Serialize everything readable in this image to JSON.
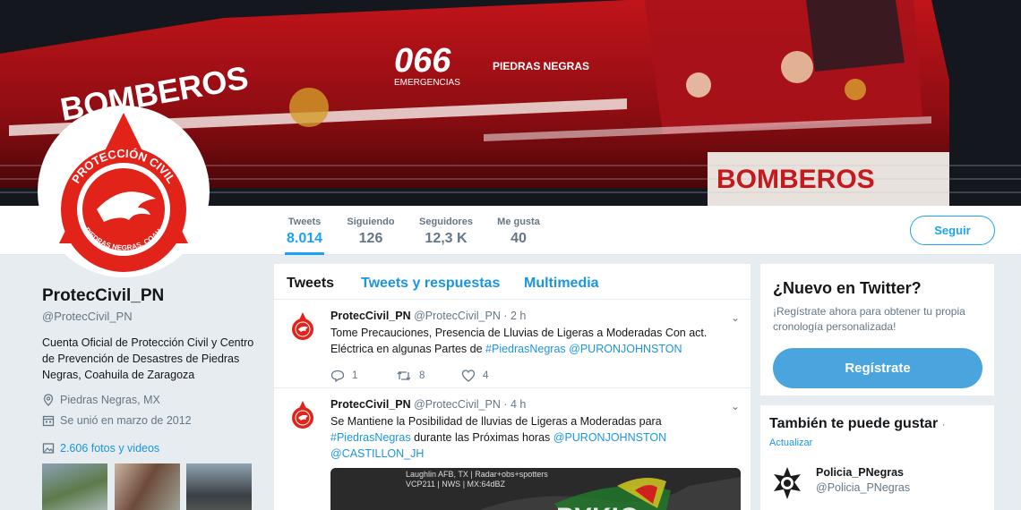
{
  "banner": {
    "truck_number": "066",
    "truck_subtext": "EMERGENCIAS",
    "truck_brand": "PIEDRAS NEGRAS",
    "side_text": "BOMBEROS",
    "bumper_text": "BOMBEROS"
  },
  "avatar": {
    "arc_top": "PROTECCIÓN CIVIL",
    "arc_bottom": "PIEDRAS NEGRAS, COAH."
  },
  "stats": [
    {
      "label": "Tweets",
      "value": "8.014"
    },
    {
      "label": "Siguiendo",
      "value": "126"
    },
    {
      "label": "Seguidores",
      "value": "12,3 K"
    },
    {
      "label": "Me gusta",
      "value": "40"
    }
  ],
  "follow_label": "Seguir",
  "profile": {
    "name": "ProtecCivil_PN",
    "handle": "@ProtecCivil_PN",
    "bio": "Cuenta Oficial de Protección Civil y Centro de Prevención de Desastres de Piedras Negras, Coahuila de Zaragoza",
    "location": "Piedras Negras, MX",
    "joined": "Se unió en marzo de 2012",
    "media": "2.606 fotos y videos"
  },
  "tabs": [
    "Tweets",
    "Tweets y respuestas",
    "Multimedia"
  ],
  "tweets": [
    {
      "name": "ProtecCivil_PN",
      "handle": "@ProtecCivil_PN",
      "time": "2 h",
      "text_a": "Tome Precauciones, Presencia de Lluvias de Ligeras a Moderadas Con act. Eléctrica en algunas Partes de ",
      "tag_1": "#PiedrasNegras",
      "mention_1": "@PURONJOHNSTON",
      "replies": "1",
      "retweets": "8",
      "likes": "4"
    },
    {
      "name": "ProtecCivil_PN",
      "handle": "@ProtecCivil_PN",
      "time": "4 h",
      "text_a": "Se Mantiene la Posibilidad de lluvias de Ligeras a Moderadas para ",
      "tag_1": "#PiedrasNegras",
      "text_b": " durante las Próximas horas ",
      "mention_1": "@PURONJOHNSTON",
      "mention_2": "@CASTILLON_JH",
      "radar_line1": "Laughlin AFB, TX | Radar+obs+spotters",
      "radar_line2": "VCP211 | NWS | MX:64dBZ",
      "radar_big": "PYKIO"
    }
  ],
  "signup_card": {
    "title": "¿Nuevo en Twitter?",
    "subtitle": "¡Regístrate ahora para obtener tu propia cronología personalizada!",
    "button": "Regístrate"
  },
  "suggest_card": {
    "title": "También te puede gustar",
    "separator": "·",
    "refresh": "Actualizar",
    "account_name": "Policia_PNegras",
    "account_handle": "@Policia_PNegras"
  },
  "colors": {
    "accent": "#1da1f2",
    "link": "#1b95e0",
    "brand_red": "#e2231a",
    "background": "#e6ecf0"
  },
  "icons": [
    "caret-down-icon",
    "reply-icon",
    "retweet-icon",
    "like-icon",
    "location-icon",
    "calendar-icon",
    "photo-icon"
  ]
}
